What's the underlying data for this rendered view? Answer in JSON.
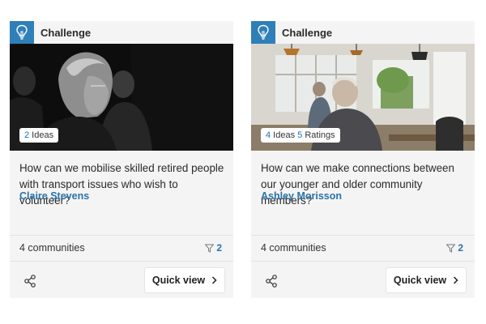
{
  "cards": [
    {
      "type_label": "Challenge",
      "type_icon": "lightbulb-icon",
      "badge": [
        {
          "num": "2",
          "text": " Ideas"
        }
      ],
      "title": "How can we mobilise skilled retired people with transport issues who wish to volunteer?",
      "author": "Claire Stevens",
      "communities": "4 communities",
      "filter_count": "2",
      "quick_view": "Quick view"
    },
    {
      "type_label": "Challenge",
      "type_icon": "lightbulb-icon",
      "badge": [
        {
          "num": "4",
          "text": " Ideas "
        },
        {
          "num": "5",
          "text": " Ratings"
        }
      ],
      "title": "How can we make connections between our younger and older community members?",
      "author": "Ashley Morisson",
      "communities": "4 communities",
      "filter_count": "2",
      "quick_view": "Quick view"
    }
  ],
  "colors": {
    "accent": "#2f7fb8",
    "link": "#2a73a9",
    "card_bg": "#f4f4f5"
  }
}
